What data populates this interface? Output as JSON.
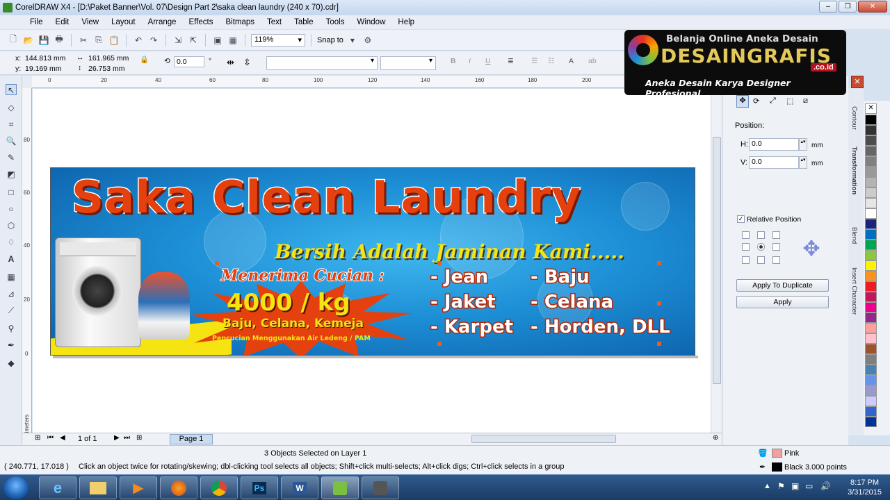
{
  "window": {
    "title": "CorelDRAW X4 - [D:\\Paket Banner\\Vol. 07\\Design Part 2\\saka clean laundry (240 x 70).cdr]"
  },
  "menu": [
    "File",
    "Edit",
    "View",
    "Layout",
    "Arrange",
    "Effects",
    "Bitmaps",
    "Text",
    "Table",
    "Tools",
    "Window",
    "Help"
  ],
  "toolbar": {
    "zoom": "119%",
    "snap_to": "Snap to"
  },
  "property_bar": {
    "x": "144.813 mm",
    "y": "19.169 mm",
    "width": "161.965 mm",
    "height": "26.753 mm",
    "angle": "0.0",
    "angle_unit": "°"
  },
  "ruler": {
    "h_ticks": [
      "0",
      "20",
      "40",
      "60",
      "80",
      "100",
      "120",
      "140",
      "160",
      "180",
      "200"
    ],
    "v_ticks": [
      "80",
      "60",
      "40",
      "20",
      "0"
    ],
    "unit": "millimeters"
  },
  "banner": {
    "title": "Saka Clean Laundry",
    "tagline": "Bersih Adalah Jaminan Kami.....",
    "accept": "Menerima Cucian :",
    "price": "4000 / kg",
    "kinds": "Baju, Celana, Kemeja",
    "note": "Pencucian Menggunakan Air Ledeng / PAM",
    "items_left": [
      "- Jean",
      "- Jaket",
      "- Karpet"
    ],
    "items_right": [
      "- Baju",
      "- Celana",
      "- Horden, DLL"
    ]
  },
  "logo": {
    "line1": "Belanja Online Aneka Desain",
    "brand": "DESAINGRAFIS",
    "domain": ".co.id",
    "line3": "Aneka Desain Karya Designer Profesional"
  },
  "docker": {
    "position_label": "Position:",
    "h_label": "H:",
    "h_value": "0.0",
    "v_label": "V:",
    "v_value": "0.0",
    "unit": "mm",
    "relative_position": "Relative Position",
    "apply_duplicate": "Apply To Duplicate",
    "apply": "Apply",
    "tabs": [
      "Contour",
      "Transformation",
      "Blend",
      "Insert Character"
    ]
  },
  "page_nav": {
    "page_of": "1 of 1",
    "page_tab": "Page 1"
  },
  "status": {
    "selection": "3 Objects Selected on Layer 1",
    "coords": "( 240.771, 17.018 )",
    "hint": "Click an object twice for rotating/skewing; dbl-clicking tool selects all objects; Shift+click multi-selects; Alt+click digs; Ctrl+click selects in a group",
    "fill_name": "Pink",
    "outline": "Black  3.000 points",
    "fill_color": "#f0a0a0"
  },
  "taskbar": {
    "time": "8:17 PM",
    "date": "3/31/2015",
    "apps": [
      "ie-icon",
      "explorer-icon",
      "media-icon",
      "firefox-icon",
      "chrome-icon",
      "photoshop-icon",
      "word-icon",
      "coreldraw-icon",
      "corel-capture-icon"
    ],
    "ps_label": "Ps",
    "word_label": "W"
  },
  "palette_colors": [
    "#000000",
    "#333333",
    "#4d4d4d",
    "#666666",
    "#808080",
    "#999999",
    "#b3b3b3",
    "#cccccc",
    "#e6e6e6",
    "#ffffff",
    "#1a237e",
    "#0070c0",
    "#00a550",
    "#8dc63f",
    "#fff200",
    "#f7941d",
    "#ed1c24",
    "#c2185b",
    "#ec008c",
    "#92278f",
    "#f9a19a",
    "#ffc0cb",
    "#a0522d",
    "#7f7f7f",
    "#4682b4",
    "#6495ed",
    "#9999cc",
    "#ccccff",
    "#3366cc",
    "#003399"
  ]
}
